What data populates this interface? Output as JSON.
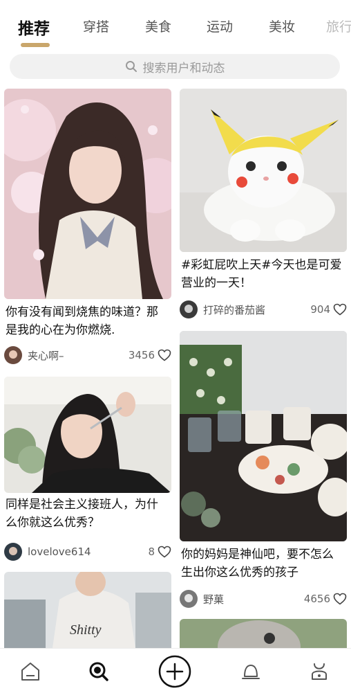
{
  "tabs": [
    {
      "label": "推荐",
      "active": true
    },
    {
      "label": "穿搭"
    },
    {
      "label": "美食"
    },
    {
      "label": "运动"
    },
    {
      "label": "美妆"
    },
    {
      "label": "旅行"
    }
  ],
  "search": {
    "placeholder": "搜索用户和动态"
  },
  "feed": {
    "left": [
      {
        "caption": "你有没有闻到烧焦的味道？那\n是我的心在为你燃烧.",
        "author": "夹心啊–",
        "likes": "3456"
      },
      {
        "caption": "同样是社会主义接班人，为什\n么你就这么优秀？",
        "author": "lovelove614",
        "likes": "8"
      }
    ],
    "right": [
      {
        "caption": "#彩虹屁吹上天#今天也是可爱\n营业的一天！",
        "author": "打碎的番茄酱",
        "likes": "904"
      },
      {
        "caption": "你的妈妈是神仙吧，要不怎么\n生出你这么优秀的孩子",
        "author": "野菓",
        "likes": "4656"
      }
    ]
  },
  "bottom_nav": [
    {
      "icon": "home-icon"
    },
    {
      "icon": "discover-icon",
      "active": true
    },
    {
      "icon": "add-icon"
    },
    {
      "icon": "notification-icon"
    },
    {
      "icon": "profile-icon"
    }
  ],
  "colors": {
    "accent": "#c9a66b",
    "search_bg": "#f1f1f1"
  }
}
